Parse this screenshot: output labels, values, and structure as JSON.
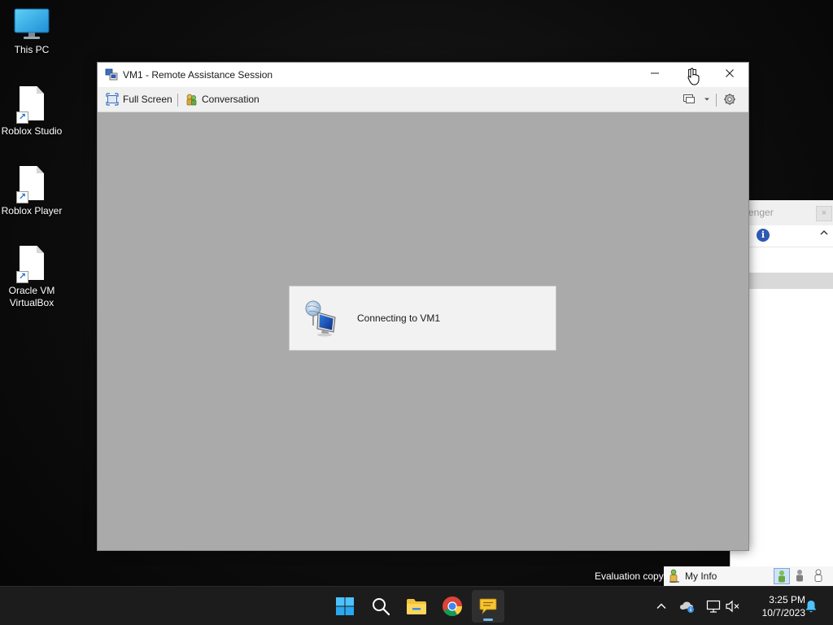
{
  "desktop": {
    "icons": [
      {
        "label": "This PC",
        "icon": "monitor-icon"
      },
      {
        "label": "Roblox Studio",
        "icon": "file-shortcut-icon"
      },
      {
        "label": "Roblox Player",
        "icon": "file-shortcut-icon"
      },
      {
        "label": "Oracle VM VirtualBox",
        "icon": "file-shortcut-icon"
      }
    ]
  },
  "ra_window": {
    "title": "VM1 - Remote Assistance Session",
    "toolbar": {
      "full_screen": "Full Screen",
      "conversation": "Conversation"
    },
    "status_message": "Connecting to VM1",
    "background_color": "#aaaaaa"
  },
  "messenger": {
    "title_fragment": "enger",
    "close_glyph": "×"
  },
  "status_strip": {
    "evaluation_text": "Evaluation copy",
    "my_info": "My Info"
  },
  "taskbar": {
    "apps": [
      "start-icon",
      "search-icon",
      "file-explorer-icon",
      "chrome-icon",
      "messenger-icon"
    ],
    "active_app": "messenger-icon",
    "accent_color": "#76b9ed"
  },
  "clock": {
    "time": "3:25 PM",
    "date": "10/7/2023"
  }
}
